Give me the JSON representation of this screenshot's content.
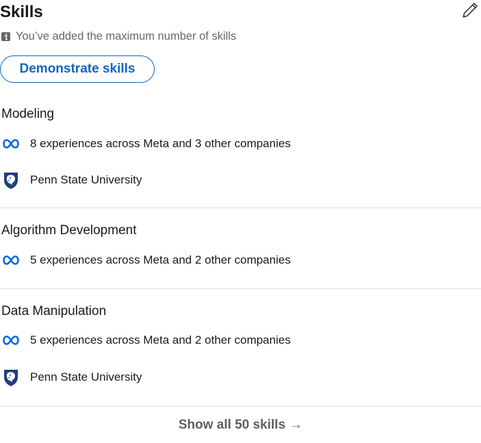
{
  "header": {
    "title": "Skills",
    "max_note": "You’ve added the maximum number of skills",
    "edit_icon": "pencil-icon"
  },
  "actions": {
    "demonstrate_label": "Demonstrate skills",
    "show_all_label": "Show all 50 skills",
    "show_all_arrow": "→"
  },
  "skills": [
    {
      "name": "Modeling",
      "details": [
        {
          "icon": "meta-logo-icon",
          "text": "8 experiences across Meta and 3 other companies"
        },
        {
          "icon": "penn-state-logo-icon",
          "text": "Penn State University"
        }
      ]
    },
    {
      "name": "Algorithm Development",
      "details": [
        {
          "icon": "meta-logo-icon",
          "text": "5 experiences across Meta and 2 other companies"
        }
      ]
    },
    {
      "name": "Data Manipulation",
      "details": [
        {
          "icon": "meta-logo-icon",
          "text": "5 experiences across Meta and 2 other companies"
        },
        {
          "icon": "penn-state-logo-icon",
          "text": "Penn State University"
        }
      ]
    }
  ],
  "colors": {
    "accent": "#0a66c2",
    "meta_blue": "#0668e1",
    "penn_navy": "#1e407c",
    "muted_text": "#666666"
  }
}
